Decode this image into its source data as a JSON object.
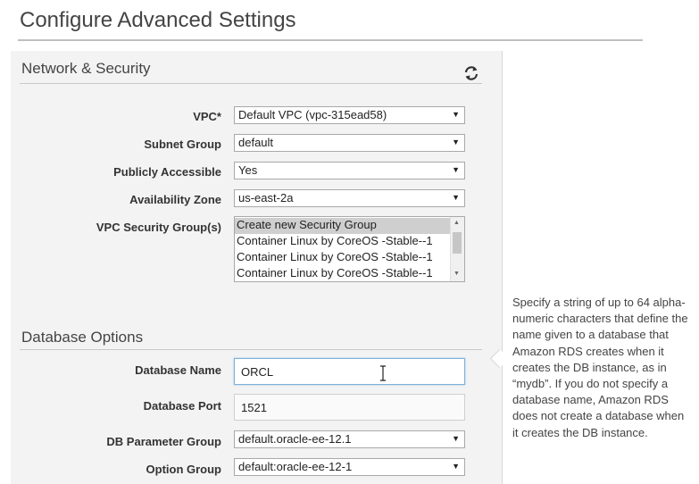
{
  "page": {
    "title": "Configure Advanced Settings"
  },
  "network_security": {
    "title": "Network & Security",
    "refresh_icon": "refresh-icon",
    "vpc": {
      "label": "VPC*",
      "value": "Default VPC (vpc-315ead58)"
    },
    "subnet_group": {
      "label": "Subnet Group",
      "value": "default"
    },
    "publicly_accessible": {
      "label": "Publicly Accessible",
      "value": "Yes"
    },
    "availability_zone": {
      "label": "Availability Zone",
      "value": "us-east-2a"
    },
    "security_groups": {
      "label": "VPC Security Group(s)",
      "items": [
        "Create new Security Group",
        "Container Linux by CoreOS -Stable--1",
        "Container Linux by CoreOS -Stable--1",
        "Container Linux by CoreOS -Stable--1"
      ],
      "selected": "Create new Security Group"
    }
  },
  "database_options": {
    "title": "Database Options",
    "database_name": {
      "label": "Database Name",
      "value": "ORCL"
    },
    "database_port": {
      "label": "Database Port",
      "value": "1521"
    },
    "db_parameter_group": {
      "label": "DB Parameter Group",
      "value": "default.oracle-ee-12.1"
    },
    "option_group": {
      "label": "Option Group",
      "value": "default:oracle-ee-12-1"
    }
  },
  "help": {
    "text": "Specify a string of up to 64 alpha-numeric characters that define the name given to a database that Amazon RDS creates when it creates the DB instance, as in “mydb”. If you do not specify a database name, Amazon RDS does not create a database when it creates the DB instance."
  },
  "colors": {
    "panel_bg": "#f3f3f3",
    "focus_border": "#7fb1d8",
    "selected_item": "#cfcfcf"
  }
}
